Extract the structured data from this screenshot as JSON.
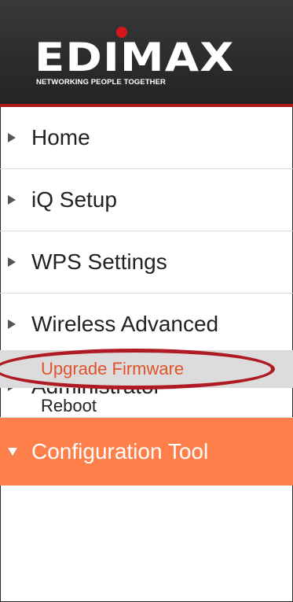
{
  "brand": {
    "logo_text": "EDIMAX",
    "tagline": "NETWORKING PEOPLE TOGETHER",
    "accent_color": "#d5171d"
  },
  "menu": {
    "items": [
      {
        "label": "Home",
        "icon": "triangle-right-icon"
      },
      {
        "label": "iQ Setup",
        "icon": "triangle-right-icon"
      },
      {
        "label": "WPS Settings",
        "icon": "triangle-right-icon"
      },
      {
        "label": "Wireless Advanced",
        "icon": "triangle-right-icon"
      },
      {
        "label": "Administrator",
        "icon": "triangle-right-icon"
      },
      {
        "label": "Configuration Tool",
        "icon": "triangle-down-icon",
        "active": true
      }
    ],
    "active_color": "#ff7f4a"
  },
  "submenu": {
    "items": [
      {
        "label": "Upgrade Firmware",
        "selected": true
      },
      {
        "label": "Reboot",
        "selected": false
      }
    ],
    "selected_color": "#e2522a",
    "highlight_color": "#b01a22"
  }
}
